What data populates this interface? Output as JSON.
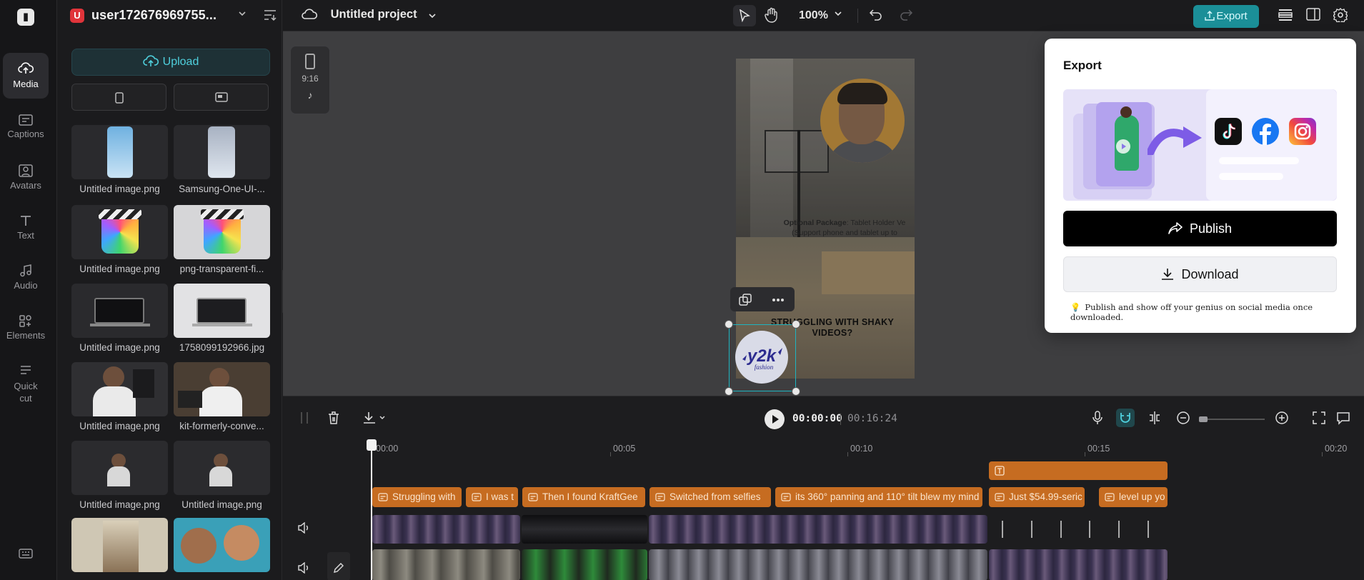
{
  "rail": {
    "items": [
      {
        "label": "Media",
        "icon": "cloud-upload-icon",
        "active": true
      },
      {
        "label": "Captions",
        "icon": "captions-icon"
      },
      {
        "label": "Avatars",
        "icon": "avatar-icon"
      },
      {
        "label": "Text",
        "icon": "text-icon"
      },
      {
        "label": "Audio",
        "icon": "music-icon"
      },
      {
        "label": "Elements",
        "icon": "elements-icon"
      },
      {
        "label": "Quick cut",
        "icon": "scissors-icon"
      }
    ]
  },
  "panel": {
    "user_initial": "U",
    "user_name": "user172676969755...",
    "upload_label": "Upload",
    "media": [
      {
        "label": "Untitled image.png"
      },
      {
        "label": "Samsung-One-UI-..."
      },
      {
        "label": "Untitled image.png"
      },
      {
        "label": "png-transparent-fi..."
      },
      {
        "label": "Untitled image.png"
      },
      {
        "label": "1758099192966.jpg"
      },
      {
        "label": "Untitled image.png"
      },
      {
        "label": "kit-formerly-conve..."
      },
      {
        "label": "Untitled image.png"
      },
      {
        "label": "Untitled image.png"
      },
      {
        "label": ""
      },
      {
        "label": ""
      }
    ]
  },
  "topbar": {
    "project_title": "Untitled project",
    "zoom": "100%",
    "export_label": "Export"
  },
  "canvas": {
    "ratio_label": "9:16",
    "caption_line1_bold": "Optional Package",
    "caption_line1_rest": ": Tablet Holder Ve",
    "caption_line2": "(Support phone and tablet up to",
    "headline_line1": "STRUGGLING WITH SHAKY",
    "headline_line2": "VIDEOS?"
  },
  "export_popup": {
    "title": "Export",
    "publish_label": "Publish",
    "download_label": "Download",
    "hint": "Publish and show off your genius on social media once downloaded."
  },
  "timeline": {
    "current_time": "00:00:00",
    "total_time": "00:16:24",
    "ruler": [
      "00:00",
      "00:05",
      "00:10",
      "00:15",
      "00:20"
    ],
    "captions": [
      "Struggling with",
      "I was t",
      "Then I found KraftGee",
      "Switched from selfies",
      "its 360° panning and 110° tilt blew my mind",
      "Just $54.99-seric",
      "level up yo"
    ]
  },
  "colors": {
    "accent": "#1b8f98",
    "caption_clip": "#c66c21",
    "upload_text": "#4fd0dd"
  }
}
